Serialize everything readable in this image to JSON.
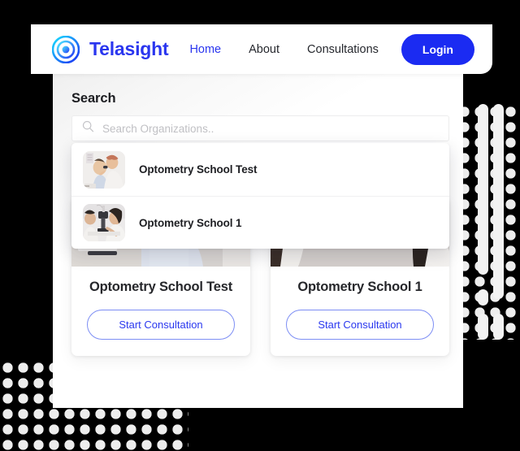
{
  "brand": {
    "name": "Telasight",
    "logo_icon": "concentric-eye-icon",
    "logo_colors": [
      "#00d9ff",
      "#1b2bf2"
    ],
    "name_color": "#2a36ef"
  },
  "nav": {
    "items": [
      {
        "label": "Home",
        "active": true
      },
      {
        "label": "About",
        "active": false
      },
      {
        "label": "Consultations",
        "active": false
      }
    ],
    "login_label": "Login",
    "login_bg": "#1b2bf2"
  },
  "search": {
    "heading": "Search",
    "placeholder": "Search Organizations..",
    "value": "",
    "icon": "search-icon"
  },
  "suggestions": [
    {
      "label": "Optometry School Test",
      "thumb": "child-eye-exam-photo"
    },
    {
      "label": "Optometry School 1",
      "thumb": "slit-lamp-exam-photo"
    }
  ],
  "cards": [
    {
      "title": "Optometry School Test",
      "cta_label": "Start Consultation",
      "media": "clinician-patient-photo"
    },
    {
      "title": "Optometry School 1",
      "cta_label": "Start Consultation",
      "media": "eye-clinic-photo"
    }
  ],
  "theme": {
    "accent": "#1b2bf2",
    "accent_soft": "#7d8ef4",
    "page_bg": "#000000",
    "panel_bg": "#ffffff",
    "dot_color": "#ededed"
  }
}
